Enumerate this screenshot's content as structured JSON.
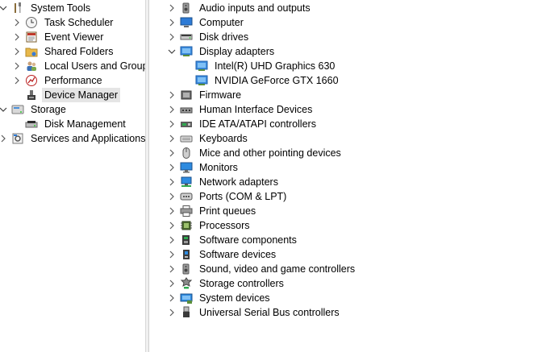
{
  "left_tree": [
    {
      "label": "System Tools",
      "icon": "system-tools-icon",
      "expander": "chevron-down"
    },
    {
      "label": "Task Scheduler",
      "icon": "clock-icon",
      "expander": "chevron-right"
    },
    {
      "label": "Event Viewer",
      "icon": "event-viewer-icon",
      "expander": "chevron-right"
    },
    {
      "label": "Shared Folders",
      "icon": "shared-folder-icon",
      "expander": "chevron-right"
    },
    {
      "label": "Local Users and Groups",
      "icon": "users-icon",
      "expander": "chevron-right"
    },
    {
      "label": "Performance",
      "icon": "performance-icon",
      "expander": "chevron-right"
    },
    {
      "label": "Device Manager",
      "icon": "device-manager-icon",
      "expander": "none",
      "selected": true
    },
    {
      "label": "Storage",
      "icon": "storage-icon",
      "expander": "chevron-down"
    },
    {
      "label": "Disk Management",
      "icon": "disk-management-icon",
      "expander": "none"
    },
    {
      "label": "Services and Applications",
      "icon": "services-icon",
      "expander": "chevron-right"
    }
  ],
  "device_tree": [
    {
      "label": "Audio inputs and outputs",
      "icon": "speaker-icon",
      "expander": "chevron-right"
    },
    {
      "label": "Computer",
      "icon": "computer-icon",
      "expander": "chevron-right"
    },
    {
      "label": "Disk drives",
      "icon": "disk-drive-icon",
      "expander": "chevron-right"
    },
    {
      "label": "Display adapters",
      "icon": "display-adapter-icon",
      "expander": "chevron-down"
    },
    {
      "label": "Intel(R) UHD Graphics 630",
      "icon": "display-adapter-icon",
      "expander": "none",
      "child": true
    },
    {
      "label": "NVIDIA GeForce GTX 1660",
      "icon": "display-adapter-icon",
      "expander": "none",
      "child": true
    },
    {
      "label": "Firmware",
      "icon": "firmware-icon",
      "expander": "chevron-right"
    },
    {
      "label": "Human Interface Devices",
      "icon": "hid-icon",
      "expander": "chevron-right"
    },
    {
      "label": "IDE ATA/ATAPI controllers",
      "icon": "ide-controller-icon",
      "expander": "chevron-right"
    },
    {
      "label": "Keyboards",
      "icon": "keyboard-icon",
      "expander": "chevron-right"
    },
    {
      "label": "Mice and other pointing devices",
      "icon": "mouse-icon",
      "expander": "chevron-right"
    },
    {
      "label": "Monitors",
      "icon": "monitor-icon",
      "expander": "chevron-right"
    },
    {
      "label": "Network adapters",
      "icon": "network-adapter-icon",
      "expander": "chevron-right"
    },
    {
      "label": "Ports (COM & LPT)",
      "icon": "port-icon",
      "expander": "chevron-right"
    },
    {
      "label": "Print queues",
      "icon": "printer-icon",
      "expander": "chevron-right"
    },
    {
      "label": "Processors",
      "icon": "processor-icon",
      "expander": "chevron-right"
    },
    {
      "label": "Software components",
      "icon": "software-component-icon",
      "expander": "chevron-right"
    },
    {
      "label": "Software devices",
      "icon": "software-device-icon",
      "expander": "chevron-right"
    },
    {
      "label": "Sound, video and game controllers",
      "icon": "speaker-icon",
      "expander": "chevron-right"
    },
    {
      "label": "Storage controllers",
      "icon": "storage-controller-icon",
      "expander": "chevron-right"
    },
    {
      "label": "System devices",
      "icon": "system-devices-icon",
      "expander": "chevron-right"
    },
    {
      "label": "Universal Serial Bus controllers",
      "icon": "usb-icon",
      "expander": "chevron-right"
    }
  ]
}
